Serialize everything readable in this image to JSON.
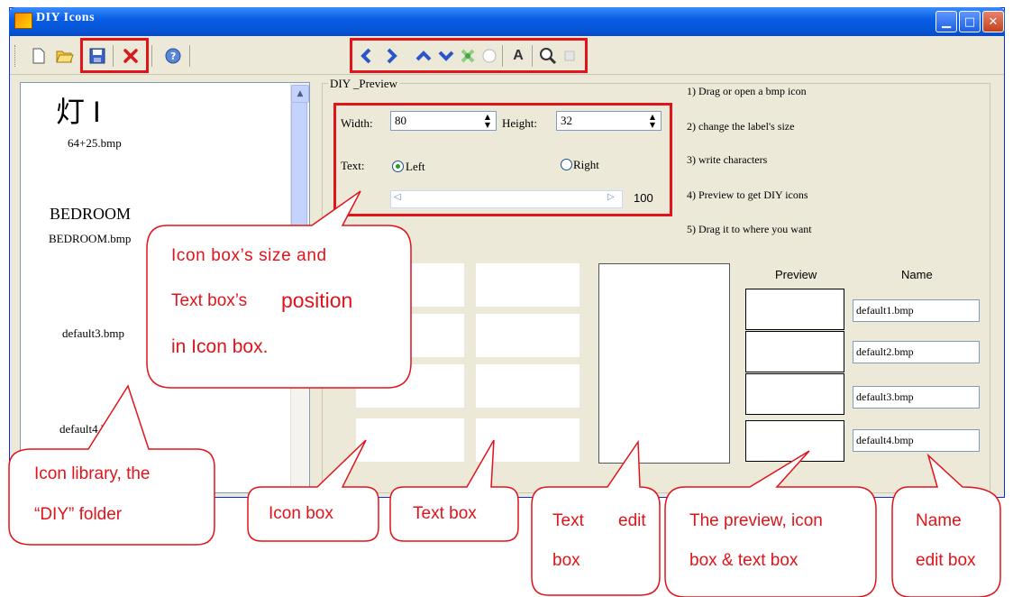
{
  "window": {
    "title": "DIY Icons"
  },
  "icon_list": {
    "items": [
      {
        "glyph": "灯 I",
        "label": "64+25.bmp"
      },
      {
        "glyph": "BEDROOM",
        "label": "BEDROOM.bmp"
      },
      {
        "glyph": "",
        "label": "default3.bmp"
      },
      {
        "glyph": "",
        "label": "default4.bm"
      }
    ]
  },
  "preview_group": {
    "title": "DIY _Preview",
    "width_label": "Width:",
    "width_value": "80",
    "height_label": "Height:",
    "height_value": "32",
    "text_label": "Text:",
    "left_option": "Left",
    "right_option": "Right",
    "text_align_selected": "Left",
    "slider_value": "100",
    "instructions": [
      "1) Drag or open a bmp icon",
      "2) change the label's size",
      "3) write characters",
      "4) Preview to get DIY icons",
      "5) Drag it to where you want"
    ],
    "preview_header": "Preview",
    "name_header": "Name",
    "names": [
      "default1.bmp",
      "default2.bmp",
      "default3.bmp",
      "default4.bmp"
    ]
  },
  "callouts": {
    "size_position": [
      "Icon box’s size and",
      "Text box’s",
      "position",
      "in Icon box."
    ],
    "icon_library": [
      "Icon library, the",
      "“DIY” folder"
    ],
    "icon_box": "Icon box",
    "text_box": "Text box",
    "text_edit_box": [
      "Text",
      "edit",
      "box"
    ],
    "preview_box": [
      "The preview, icon",
      "box & text box"
    ],
    "name_edit_box": [
      "Name",
      "edit box"
    ]
  },
  "colors": {
    "highlight": "#e0141a",
    "titlebar": "#0a5fe6",
    "window_bg": "#ece9d8"
  },
  "icons": [
    "new-icon",
    "open-folder-icon",
    "save-icon",
    "delete-icon",
    "help-icon",
    "arrow-left-icon",
    "arrow-right-icon",
    "arrow-up-icon",
    "arrow-down-icon",
    "fill-icon",
    "circle-icon",
    "text-icon",
    "zoom-icon",
    "copy-icon"
  ]
}
